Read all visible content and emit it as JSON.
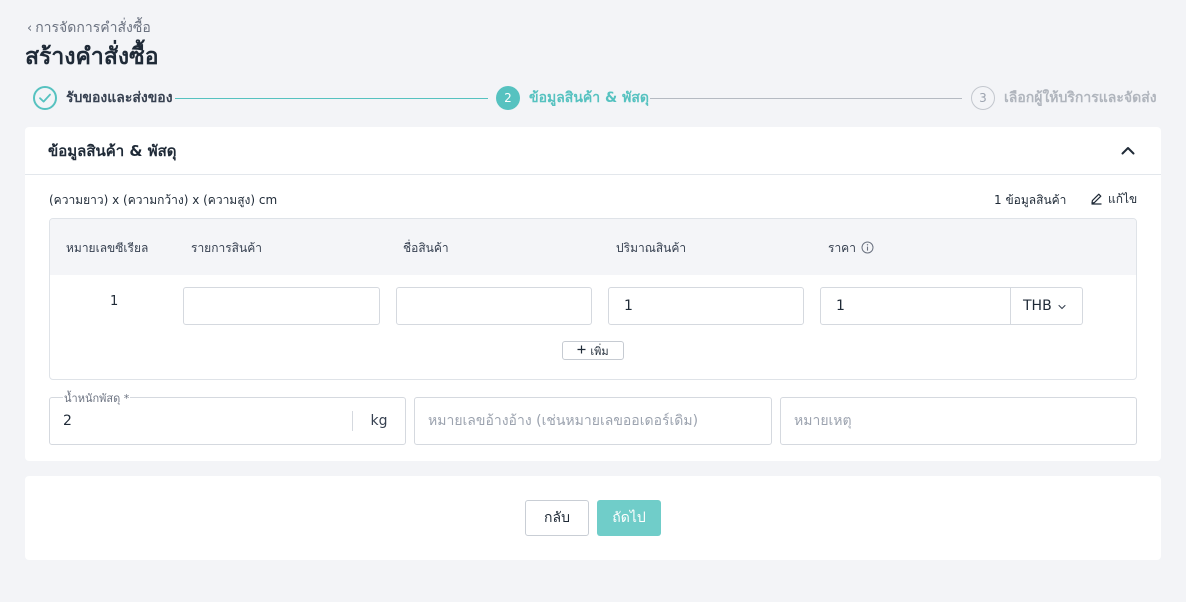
{
  "breadcrumb": {
    "label": "การจัดการคำสั่งซื้อ"
  },
  "page": {
    "title": "สร้างคำสั่งซื้อ"
  },
  "stepper": {
    "steps": [
      {
        "number": "1",
        "label": "รับของและส่งของ",
        "status": "completed"
      },
      {
        "number": "2",
        "label": "ข้อมูลสินค้า & พัสดุ",
        "status": "active"
      },
      {
        "number": "3",
        "label": "เลือกผู้ให้บริการและจัดส่ง",
        "status": "pending"
      }
    ]
  },
  "section": {
    "title": "ข้อมูลสินค้า & พัสดุ",
    "dimensions_text": "(ความยาว) x (ความกว้าง) x (ความสูง) cm",
    "item_count_text": "1 ข้อมูลสินค้า",
    "edit_label": "แก้ไข"
  },
  "table": {
    "columns": [
      "หมายเลขซีเรียล",
      "รายการสินค้า",
      "ชื่อสินค้า",
      "ปริมาณสินค้า",
      "ราคา"
    ],
    "rows": [
      {
        "serial": "1",
        "item": "",
        "name": "",
        "quantity": "1",
        "price": "1",
        "currency": "THB"
      }
    ],
    "add_label": "เพิ่ม"
  },
  "parcel": {
    "weight_label": "น้ำหนักพัสดุ *",
    "weight_value": "2",
    "weight_unit": "kg",
    "reference_placeholder": "หมายเลขอ้างอ้าง (เช่นหมายเลขออเดอร์เดิม)",
    "note_placeholder": "หมายเหตุ"
  },
  "footer": {
    "back_label": "กลับ",
    "next_label": "ถัดไป"
  },
  "colors": {
    "accent": "#56c2c0",
    "accent_button": "#70cdc9",
    "background": "#f3f4f7"
  },
  "icons": [
    "chevron-left-icon",
    "check-icon",
    "chevron-up-icon",
    "pencil-icon",
    "info-icon",
    "chevron-down-icon",
    "plus-icon"
  ]
}
